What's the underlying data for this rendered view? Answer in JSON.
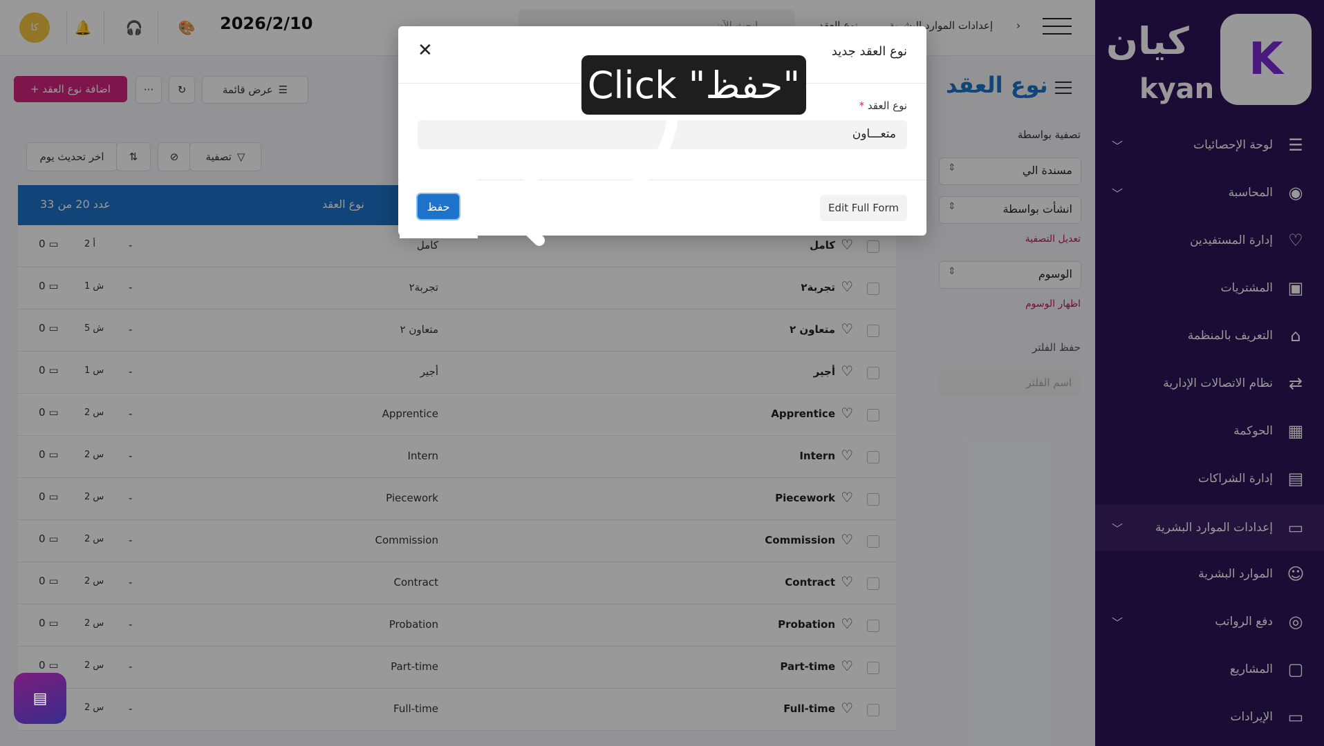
{
  "topbar": {
    "date": "2026/2/10",
    "avatar_initials": "كا",
    "search_placeholder": "ابحث الآن",
    "breadcrumb_1": "إعدادات الموارد البشرية",
    "breadcrumb_2": "نوع العقد",
    "breadcrumb_sep": "›"
  },
  "brand": {
    "name_ar": "كيان",
    "name_en": "kyan",
    "logo_mark": "K"
  },
  "sidebar": {
    "items": [
      {
        "label": "لوحة الإحصائيات",
        "icon": "☰",
        "chevron": true
      },
      {
        "label": "المحاسبة",
        "icon": "◉",
        "chevron": true
      },
      {
        "label": "إدارة المستفيدين",
        "icon": "♡",
        "chevron": false
      },
      {
        "label": "المشتريات",
        "icon": "▣",
        "chevron": false
      },
      {
        "label": "التعريف بالمنظمة",
        "icon": "⌂",
        "chevron": false
      },
      {
        "label": "نظام الاتصالات الإدارية",
        "icon": "⇄",
        "chevron": false
      },
      {
        "label": "الحوكمة",
        "icon": "▦",
        "chevron": false
      },
      {
        "label": "إدارة الشراكات",
        "icon": "▤",
        "chevron": false
      },
      {
        "label": "إعدادات الموارد البشرية",
        "icon": "▭",
        "chevron": true,
        "active": true
      },
      {
        "label": "الموارد البشرية",
        "icon": "☺",
        "chevron": false
      },
      {
        "label": "دفع الرواتب",
        "icon": "◎",
        "chevron": true
      },
      {
        "label": "المشاريع",
        "icon": "▢",
        "chevron": false
      },
      {
        "label": "الإيرادات",
        "icon": "▭",
        "chevron": false
      }
    ]
  },
  "filter_panel": {
    "title": "نوع العقد",
    "filter_by": "تصفية بواسطة",
    "assigned_to": "مسندة الي",
    "created_by": "انشأت بواسطة",
    "edit_filter": "تعديل التصفية",
    "tags": "الوسوم",
    "show_tags": "اظهار الوسوم",
    "save_filter": "حفظ الفلتر",
    "filter_name_placeholder": "اسم الفلتر"
  },
  "toolbar": {
    "add_label": "+ اضافة نوع العقد",
    "more": "···",
    "refresh": "↻",
    "view_list": "عرض قائمة",
    "last_update": "اخر تحديث يوم",
    "filter": "تصفية",
    "sort_icon": "⇅",
    "clear_filter_icon": "⊘"
  },
  "table": {
    "headers": {
      "type": "نوع العقد",
      "count": "عدد 20 من 33"
    },
    "rows": [
      {
        "name": "كامل",
        "type": "كامل",
        "time": "2 أ"
      },
      {
        "name": "تجربة٢",
        "type": "تجربة٢",
        "time": "1 ش"
      },
      {
        "name": "متعاون ٢",
        "type": "متعاون ٢",
        "time": "5 ش"
      },
      {
        "name": "أجير",
        "type": "أجير",
        "time": "1 س"
      },
      {
        "name": "Apprentice",
        "type": "Apprentice",
        "time": "2 س"
      },
      {
        "name": "Intern",
        "type": "Intern",
        "time": "2 س"
      },
      {
        "name": "Piecework",
        "type": "Piecework",
        "time": "2 س"
      },
      {
        "name": "Commission",
        "type": "Commission",
        "time": "2 س"
      },
      {
        "name": "Contract",
        "type": "Contract",
        "time": "2 س"
      },
      {
        "name": "Probation",
        "type": "Probation",
        "time": "2 س"
      },
      {
        "name": "Part-time",
        "type": "Part-time",
        "time": "2 س"
      },
      {
        "name": "Full-time",
        "type": "Full-time",
        "time": "2 س"
      }
    ],
    "dash": "-",
    "message_count": "0"
  },
  "modal": {
    "title": "نوع العقد جديد",
    "close": "✕",
    "field_label": "نوع العقد",
    "required_mark": "*",
    "field_value": "متعـــاون",
    "edit_full_form": "Edit Full Form",
    "save_label": "حفظ"
  },
  "callout": {
    "text": "Click \"حفظ\""
  },
  "colors": {
    "sidebar": "#2c1457",
    "primary": "#1d72c9",
    "accent": "#d3247e"
  }
}
